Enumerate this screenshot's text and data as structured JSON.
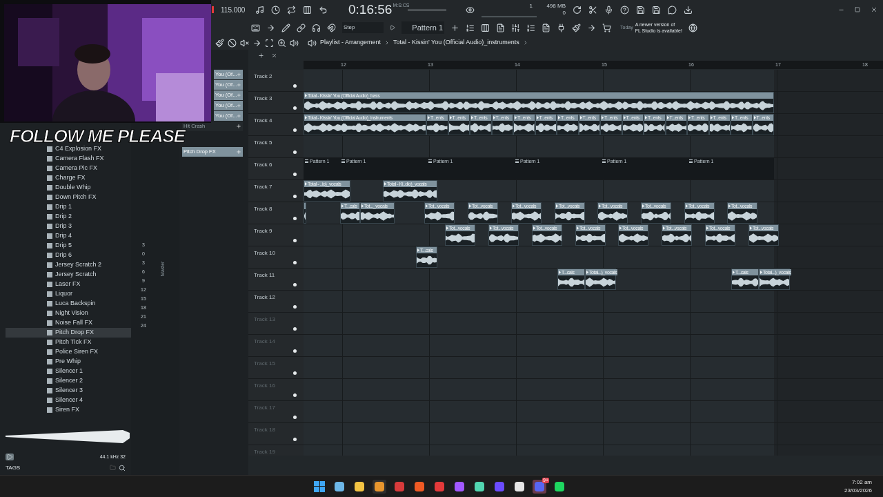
{
  "overlay_text": "FOLLOW ME PLEASE",
  "toolbar": {
    "tempo": "115.000",
    "time": "0:16:56",
    "time_unit": "M:S:CS",
    "cpu": "1",
    "memory": "498 MB",
    "polyphony": "0",
    "snap": "Step",
    "pattern": "Pattern 1",
    "news_label": "Today",
    "news_lines": [
      "A newer version of",
      "FL Studio is available!"
    ]
  },
  "breadcrumb": [
    "Playlist - Arrangement",
    "Total - Kissin' You (Official Audio)_instruments"
  ],
  "browser": {
    "items": [
      {
        "label": "C4 Explosion FX",
        "selected": false
      },
      {
        "label": "Camera Flash FX",
        "selected": false
      },
      {
        "label": "Camera Pic FX",
        "selected": false
      },
      {
        "label": "Charge FX",
        "selected": false
      },
      {
        "label": "Double Whip",
        "selected": false
      },
      {
        "label": "Down Pitch FX",
        "selected": false
      },
      {
        "label": "Drip 1",
        "selected": false
      },
      {
        "label": "Drip 2",
        "selected": false
      },
      {
        "label": "Drip 3",
        "selected": false
      },
      {
        "label": "Drip 4",
        "selected": false
      },
      {
        "label": "Drip 5",
        "selected": false
      },
      {
        "label": "Drip 6",
        "selected": false
      },
      {
        "label": "Jersey Scratch 2",
        "selected": false
      },
      {
        "label": "Jersey Scratch",
        "selected": false
      },
      {
        "label": "Laser FX",
        "selected": false
      },
      {
        "label": "Liquor",
        "selected": false
      },
      {
        "label": "Luca Backspin",
        "selected": false
      },
      {
        "label": "Night Vision",
        "selected": false
      },
      {
        "label": "Noise Fall FX",
        "selected": false
      },
      {
        "label": "Pitch Drop FX",
        "selected": true
      },
      {
        "label": "Pitch Tick FX",
        "selected": false
      },
      {
        "label": "Police Siren FX",
        "selected": false
      },
      {
        "label": "Pre Whip",
        "selected": false
      },
      {
        "label": "Silencer 1",
        "selected": false
      },
      {
        "label": "Silencer 2",
        "selected": false
      },
      {
        "label": "Silencer 3",
        "selected": false
      },
      {
        "label": "Silencer 4",
        "selected": false
      },
      {
        "label": "Siren FX",
        "selected": false
      }
    ],
    "sample_info": "44.1 kHz 32",
    "tags_label": "TAGS"
  },
  "mixer": {
    "scale": [
      "3",
      "0",
      "3",
      "6",
      "9",
      "12",
      "15",
      "18",
      "21",
      "24"
    ],
    "label": "Master"
  },
  "channels": [
    {
      "label": "You (Of...",
      "selected": true
    },
    {
      "label": "You (Of...",
      "selected": true
    },
    {
      "label": "You (Of...",
      "selected": true
    },
    {
      "label": "You (Of...",
      "selected": true
    },
    {
      "label": "You (Of...",
      "selected": true
    },
    {
      "label": "Hit Crash",
      "selected": false
    },
    {
      "label": "Pitch Drop FX",
      "selected": true
    }
  ],
  "ruler": [
    "12",
    "13",
    "14",
    "15",
    "16",
    "17",
    "18"
  ],
  "tracks": [
    {
      "name": "Track 2",
      "dimmed": false
    },
    {
      "name": "Track 3",
      "dimmed": false,
      "clips": [
        {
          "kind": "audio",
          "label": "Total - Kissin' You (Official Audio)_bass"
        }
      ]
    },
    {
      "name": "Track 4",
      "dimmed": false,
      "clips": [
        {
          "kind": "audio",
          "label": "Total - Kissin' You (Official Audio)_instruments"
        },
        {
          "kind": "audio",
          "label": "T...ents"
        },
        {
          "kind": "audio",
          "label": "T...ents"
        },
        {
          "kind": "audio",
          "label": "T...ents"
        },
        {
          "kind": "audio",
          "label": "T...ents"
        },
        {
          "kind": "audio",
          "label": "T...ents"
        },
        {
          "kind": "audio",
          "label": "T...ents"
        },
        {
          "kind": "audio",
          "label": "T...ents"
        },
        {
          "kind": "audio",
          "label": "T...ents"
        },
        {
          "kind": "audio",
          "label": "T...ents"
        },
        {
          "kind": "audio",
          "label": "T...ents"
        },
        {
          "kind": "audio",
          "label": "T...ents"
        },
        {
          "kind": "audio",
          "label": "T...ents"
        },
        {
          "kind": "audio",
          "label": "T...ents"
        },
        {
          "kind": "audio",
          "label": "T...ents"
        },
        {
          "kind": "audio",
          "label": "T...ents"
        },
        {
          "kind": "audio",
          "label": "T...ents"
        }
      ]
    },
    {
      "name": "Track 5",
      "dimmed": false
    },
    {
      "name": "Track 6",
      "dimmed": false,
      "clips": [
        {
          "kind": "pattern",
          "label": "Pattern 1"
        },
        {
          "kind": "pattern",
          "label": "Pattern 1"
        },
        {
          "kind": "pattern",
          "label": "Pattern 1"
        },
        {
          "kind": "pattern",
          "label": "Pattern 1"
        },
        {
          "kind": "pattern",
          "label": "Pattern 1"
        },
        {
          "kind": "pattern",
          "label": "Pattern 1"
        }
      ]
    },
    {
      "name": "Track 7",
      "dimmed": false,
      "clips": [
        {
          "kind": "audio",
          "label": "Total - ..io)_vocals"
        },
        {
          "kind": "audio",
          "label": "Total - Ki..dio)_vocals"
        }
      ]
    },
    {
      "name": "Track 8",
      "dimmed": false,
      "clips": [
        {
          "kind": "audio"
        },
        {
          "kind": "audio",
          "label": "T...cals"
        },
        {
          "kind": "audio",
          "label": "Tot..._vocals"
        },
        {
          "kind": "audio",
          "label": "Tot...vocals"
        },
        {
          "kind": "audio",
          "label": "Tot...vocals"
        },
        {
          "kind": "audio",
          "label": "Tot...vocals"
        },
        {
          "kind": "audio",
          "label": "Tot...vocals"
        },
        {
          "kind": "audio",
          "label": "Tot...vocals"
        },
        {
          "kind": "audio",
          "label": "Tot...vocals"
        },
        {
          "kind": "audio",
          "label": "Tot...vocals"
        },
        {
          "kind": "audio",
          "label": "Tot...vocals"
        }
      ]
    },
    {
      "name": "Track 9",
      "dimmed": false,
      "clips": [
        {
          "kind": "audio",
          "label": "Tot...vocals"
        },
        {
          "kind": "audio",
          "label": "Tot...vocals"
        },
        {
          "kind": "audio",
          "label": "Tot...vocals"
        },
        {
          "kind": "audio",
          "label": "Tot...vocals"
        },
        {
          "kind": "audio",
          "label": "Tot...vocals"
        },
        {
          "kind": "audio",
          "label": "Tot...vocals"
        },
        {
          "kind": "audio",
          "label": "Tot...vocals"
        },
        {
          "kind": "audio",
          "label": "Tot...vocals"
        }
      ]
    },
    {
      "name": "Track 10",
      "dimmed": false,
      "clips": [
        {
          "kind": "audio",
          "label": "T...cals"
        }
      ]
    },
    {
      "name": "Track 11",
      "dimmed": false,
      "clips": [
        {
          "kind": "audio",
          "label": "T...cals"
        },
        {
          "kind": "audio",
          "label": "Total...)_vocals"
        },
        {
          "kind": "audio",
          "label": "T...cals"
        },
        {
          "kind": "audio",
          "label": "Total...)_vocals"
        }
      ]
    },
    {
      "name": "Track 12",
      "dimmed": false
    },
    {
      "name": "Track 13",
      "dimmed": true
    },
    {
      "name": "Track 14",
      "dimmed": true
    },
    {
      "name": "Track 15",
      "dimmed": true
    },
    {
      "name": "Track 16",
      "dimmed": true
    },
    {
      "name": "Track 17",
      "dimmed": true
    },
    {
      "name": "Track 18",
      "dimmed": true
    },
    {
      "name": "Track 19",
      "dimmed": true
    }
  ],
  "taskbar": {
    "badge": "9+",
    "time": "7:02 am",
    "date": "23/03/2026"
  }
}
